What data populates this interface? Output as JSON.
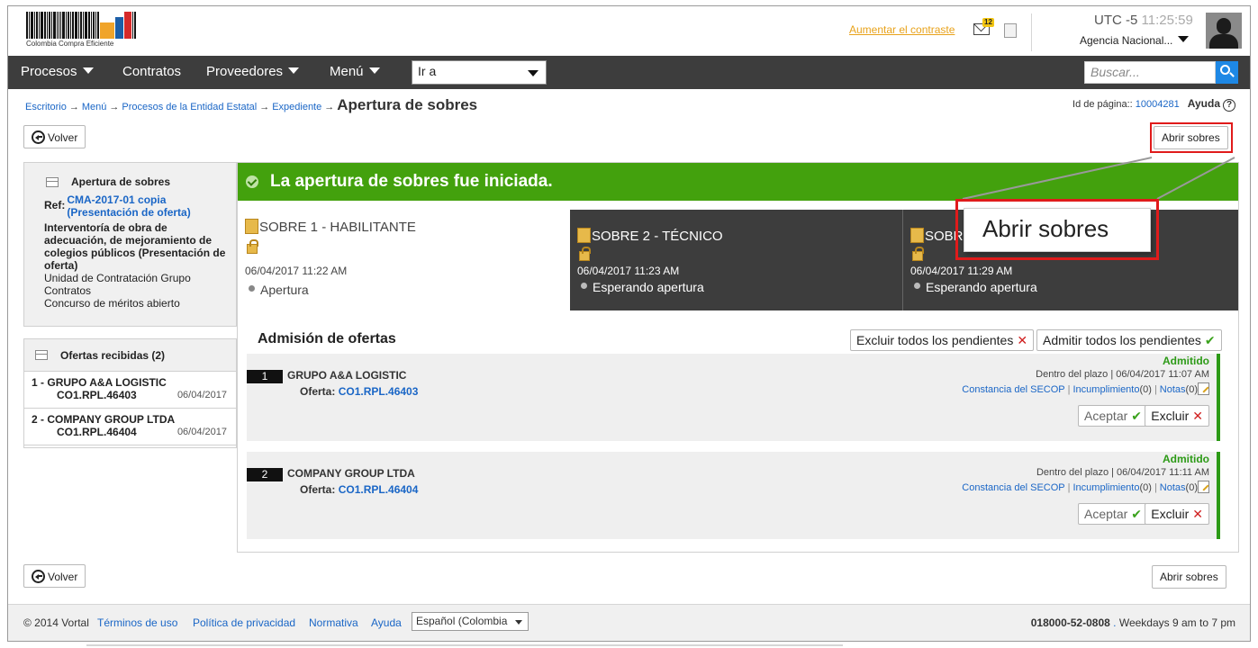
{
  "header": {
    "logo_text": "Colombia Compra Eficiente",
    "contrast_link": "Aumentar el contraste",
    "notifications_count": "12",
    "timezone": "UTC -5",
    "time": "11:25:59",
    "agency": "Agencia Nacional..."
  },
  "nav": {
    "items": [
      "Procesos",
      "Contratos",
      "Proveedores",
      "Menú"
    ],
    "goto_label": "Ir a",
    "search_placeholder": "Buscar..."
  },
  "breadcrumb": {
    "items": [
      "Escritorio",
      "Menú",
      "Procesos de la Entidad Estatal",
      "Expediente"
    ],
    "current": "Apertura de sobres",
    "page_id_label": "Id de página::",
    "page_id": "10004281",
    "help_label": "Ayuda"
  },
  "toolbar": {
    "back_label": "Volver",
    "open_label": "Abrir sobres"
  },
  "summary": {
    "title": "Apertura de sobres",
    "ref_label": "Ref:",
    "ref_value": "CMA-2017-01 copia (Presentación de oferta)",
    "description": "Interventoría de obra de adecuación, de mejoramiento de colegios públicos (Presentación de oferta)",
    "unit": "Unidad de Contratación Grupo Contratos",
    "modality": "Concurso de méritos abierto"
  },
  "offers_panel": {
    "title": "Ofertas recibidas (2)",
    "items": [
      {
        "index": "1 -",
        "name": "GRUPO A&A LOGISTIC",
        "code": "CO1.RPL.46403",
        "date": "06/04/2017"
      },
      {
        "index": "2 -",
        "name": "COMPANY GROUP LTDA",
        "code": "CO1.RPL.46404",
        "date": "06/04/2017"
      }
    ]
  },
  "main": {
    "banner": "La apertura de sobres fue iniciada.",
    "envelopes": [
      {
        "title": "SOBRE 1 - HABILITANTE",
        "date": "06/04/2017 11:22 AM",
        "status": "Apertura"
      },
      {
        "title": "SOBRE 2 - TÉCNICO",
        "date": "06/04/2017 11:23 AM",
        "status": "Esperando apertura"
      },
      {
        "title": "SOBR",
        "date": "06/04/2017 11:29 AM",
        "status": "Esperando apertura"
      }
    ],
    "admission_title": "Admisión de ofertas",
    "exclude_all": "Excluir todos los pendientes",
    "admit_all": "Admitir todos los pendientes",
    "offers": [
      {
        "num": "1",
        "name": "GRUPO A&A LOGISTIC",
        "offer_label": "Oferta:",
        "offer_code": "CO1.RPL.46403",
        "status": "Admitido",
        "timing": "Dentro del plazo | 06/04/2017 11:07 AM",
        "link1": "Constancia del SECOP",
        "link2": "Incumplimiento",
        "link2_count": "(0)",
        "link3": "Notas",
        "link3_count": "(0)",
        "accept": "Aceptar",
        "exclude": "Excluir"
      },
      {
        "num": "2",
        "name": "COMPANY GROUP LTDA",
        "offer_label": "Oferta:",
        "offer_code": "CO1.RPL.46404",
        "status": "Admitido",
        "timing": "Dentro del plazo | 06/04/2017 11:11 AM",
        "link1": "Constancia del SECOP",
        "link2": "Incumplimiento",
        "link2_count": "(0)",
        "link3": "Notas",
        "link3_count": "(0)",
        "accept": "Aceptar",
        "exclude": "Excluir"
      }
    ]
  },
  "callout": {
    "text": "Abrir sobres"
  },
  "footer": {
    "copyright": "© 2014 Vortal",
    "links": [
      "Términos de uso",
      "Política de privacidad",
      "Normativa",
      "Ayuda"
    ],
    "language": "Español (Colombia",
    "phone": "018000-52-0808",
    "hours": "Weekdays 9 am to 7 pm"
  },
  "colors": {
    "nav_bg": "#3d3d3d",
    "banner_green": "#43a10d",
    "link_blue": "#1a66c6",
    "highlight_red": "#e01b1b",
    "contrast_orange": "#e8a21a"
  }
}
